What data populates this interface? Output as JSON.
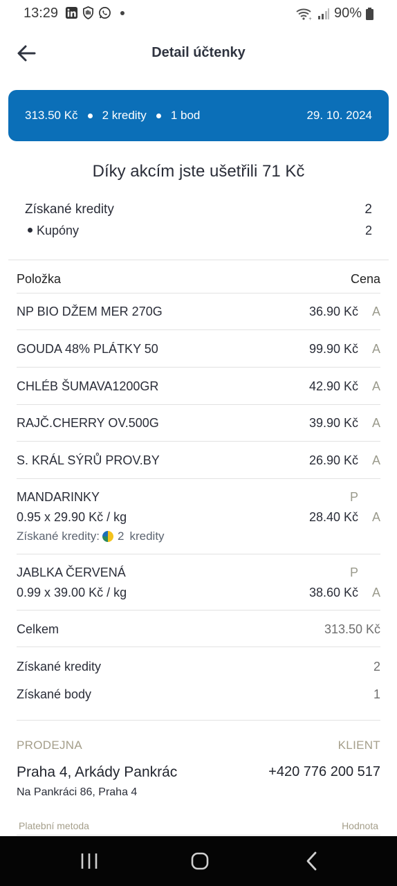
{
  "status_bar": {
    "time": "13:29",
    "battery": "90%",
    "left_icons": [
      "linkedin-icon",
      "shield-hand-icon",
      "whatsapp-icon",
      "more-dot-icon"
    ],
    "right_icons": [
      "wifi-icon",
      "signal-icon",
      "battery-icon"
    ]
  },
  "header": {
    "title": "Detail účtenky",
    "back_icon": "arrow-left-icon"
  },
  "summary": {
    "total": "313.50 Kč",
    "credits": "2 kredity",
    "points": "1 bod",
    "date": "29. 10. 2024",
    "color": "#0b6fb8"
  },
  "savings": {
    "text": "Díky akcím jste ušetřili 71 Kč"
  },
  "credits_summary": {
    "earned_label": "Získané kredity",
    "earned_value": "2",
    "coupons_label": "Kupóny",
    "coupons_value": "2"
  },
  "table": {
    "header_item": "Položka",
    "header_price": "Cena",
    "items": [
      {
        "name": "NP BIO DŽEM MER 270G",
        "price": "36.90 Kč",
        "vat": "A"
      },
      {
        "name": "GOUDA 48% PLÁTKY 50",
        "price": "99.90 Kč",
        "vat": "A"
      },
      {
        "name": "CHLÉB ŠUMAVA1200GR",
        "price": "42.90 Kč",
        "vat": "A"
      },
      {
        "name": "RAJČ.CHERRY OV.500G",
        "price": "39.90 Kč",
        "vat": "A"
      },
      {
        "name": "S. KRÁL SÝRŮ PROV.BY",
        "price": "26.90 Kč",
        "vat": "A"
      },
      {
        "name": "MANDARINKY",
        "flag": "P",
        "detail": "0.95 x 29.90 Kč / kg",
        "price": "28.40 Kč",
        "vat": "A",
        "credit_label": "Získané kredity:",
        "credit_value": "2",
        "credit_unit": "kredity"
      },
      {
        "name": "JABLKA ČERVENÁ",
        "flag": "P",
        "detail": "0.99 x 39.00 Kč / kg",
        "price": "38.60 Kč",
        "vat": "A"
      }
    ]
  },
  "totals": {
    "total_label": "Celkem",
    "total_value": "313.50 Kč",
    "credits_label": "Získané kredity",
    "credits_value": "2",
    "points_label": "Získané body",
    "points_value": "1"
  },
  "store": {
    "store_label": "PRODEJNA",
    "client_label": "KLIENT",
    "name": "Praha 4, Arkády Pankrác",
    "address": "Na Pankráci 86, Praha 4",
    "phone": "+420 776 200 517"
  },
  "payment": {
    "method_label": "Platební metoda",
    "value_label": "Hodnota"
  },
  "nav": {
    "icons": [
      "recent-apps-icon",
      "home-icon",
      "back-icon"
    ]
  }
}
